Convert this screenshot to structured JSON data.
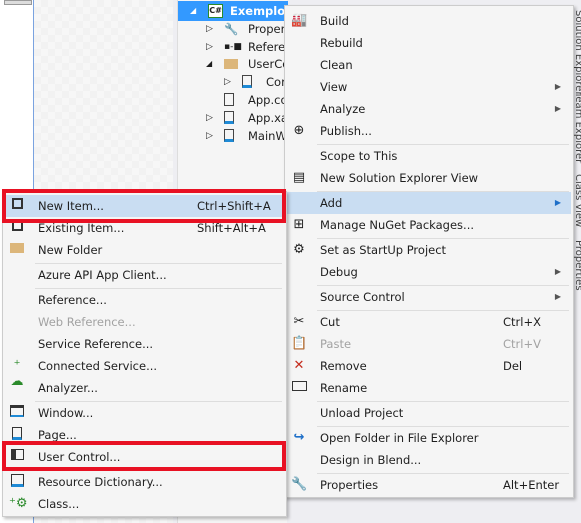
{
  "tree": {
    "items": [
      {
        "label": "ExemploU",
        "icon": "csharp-project-icon",
        "expander": "◢",
        "selected": true
      },
      {
        "label": "Proper",
        "icon": "wrench-icon",
        "expander": "▷"
      },
      {
        "label": "Referer",
        "icon": "references-icon",
        "expander": "▷"
      },
      {
        "label": "UserCo",
        "icon": "folder-icon",
        "expander": "◢"
      },
      {
        "label": "Cor",
        "icon": "xaml-file-icon",
        "expander": "▷"
      },
      {
        "label": "App.co",
        "icon": "config-file-icon",
        "expander": ""
      },
      {
        "label": "App.xa",
        "icon": "xaml-file-icon",
        "expander": "▷"
      },
      {
        "label": "MainW",
        "icon": "xaml-file-icon",
        "expander": "▷"
      }
    ]
  },
  "side_tabs": [
    "Solution Explorer",
    "Team Explorer",
    "Class View",
    "Properties"
  ],
  "context_menu": {
    "items": [
      {
        "label": "Build",
        "icon": "build-icon"
      },
      {
        "label": "Rebuild"
      },
      {
        "label": "Clean"
      },
      {
        "label": "View",
        "submenu": true
      },
      {
        "label": "Analyze",
        "submenu": true
      },
      {
        "label": "Publish...",
        "icon": "publish-icon"
      },
      {
        "label": "Scope to This"
      },
      {
        "label": "New Solution Explorer View",
        "icon": "new-view-icon"
      },
      {
        "label": "Add",
        "submenu": true,
        "highlighted": true
      },
      {
        "label": "Manage NuGet Packages...",
        "icon": "nuget-icon"
      },
      {
        "label": "Set as StartUp Project",
        "icon": "gear-icon"
      },
      {
        "label": "Debug",
        "submenu": true
      },
      {
        "label": "Source Control",
        "submenu": true
      },
      {
        "label": "Cut",
        "icon": "scissors-icon",
        "shortcut": "Ctrl+X"
      },
      {
        "label": "Paste",
        "icon": "paste-icon",
        "shortcut": "Ctrl+V",
        "disabled": true
      },
      {
        "label": "Remove",
        "icon": "remove-x-icon",
        "shortcut": "Del"
      },
      {
        "label": "Rename",
        "icon": "rename-icon"
      },
      {
        "label": "Unload Project"
      },
      {
        "label": "Open Folder in File Explorer",
        "icon": "open-folder-arrow-icon"
      },
      {
        "label": "Design in Blend..."
      },
      {
        "label": "Properties",
        "icon": "wrench-icon",
        "shortcut": "Alt+Enter"
      }
    ]
  },
  "add_submenu": {
    "items": [
      {
        "label": "New Item...",
        "icon": "new-item-icon",
        "shortcut": "Ctrl+Shift+A",
        "highlighted": true
      },
      {
        "label": "Existing Item...",
        "icon": "existing-item-icon",
        "shortcut": "Shift+Alt+A"
      },
      {
        "label": "New Folder",
        "icon": "new-folder-icon"
      },
      {
        "label": "Azure API App Client..."
      },
      {
        "label": "Reference..."
      },
      {
        "label": "Web Reference...",
        "disabled": true
      },
      {
        "label": "Service Reference..."
      },
      {
        "label": "Connected Service...",
        "icon": "connected-service-icon"
      },
      {
        "label": "Analyzer..."
      },
      {
        "label": "Window...",
        "icon": "window-icon"
      },
      {
        "label": "Page...",
        "icon": "page-icon"
      },
      {
        "label": "User Control...",
        "icon": "user-control-icon"
      },
      {
        "label": "Resource Dictionary...",
        "icon": "resource-dictionary-icon"
      },
      {
        "label": "Class...",
        "icon": "class-icon"
      }
    ]
  },
  "colors": {
    "selection": "#3399ff",
    "highlight": "#c9ddf2",
    "annotation": "#e81123"
  }
}
